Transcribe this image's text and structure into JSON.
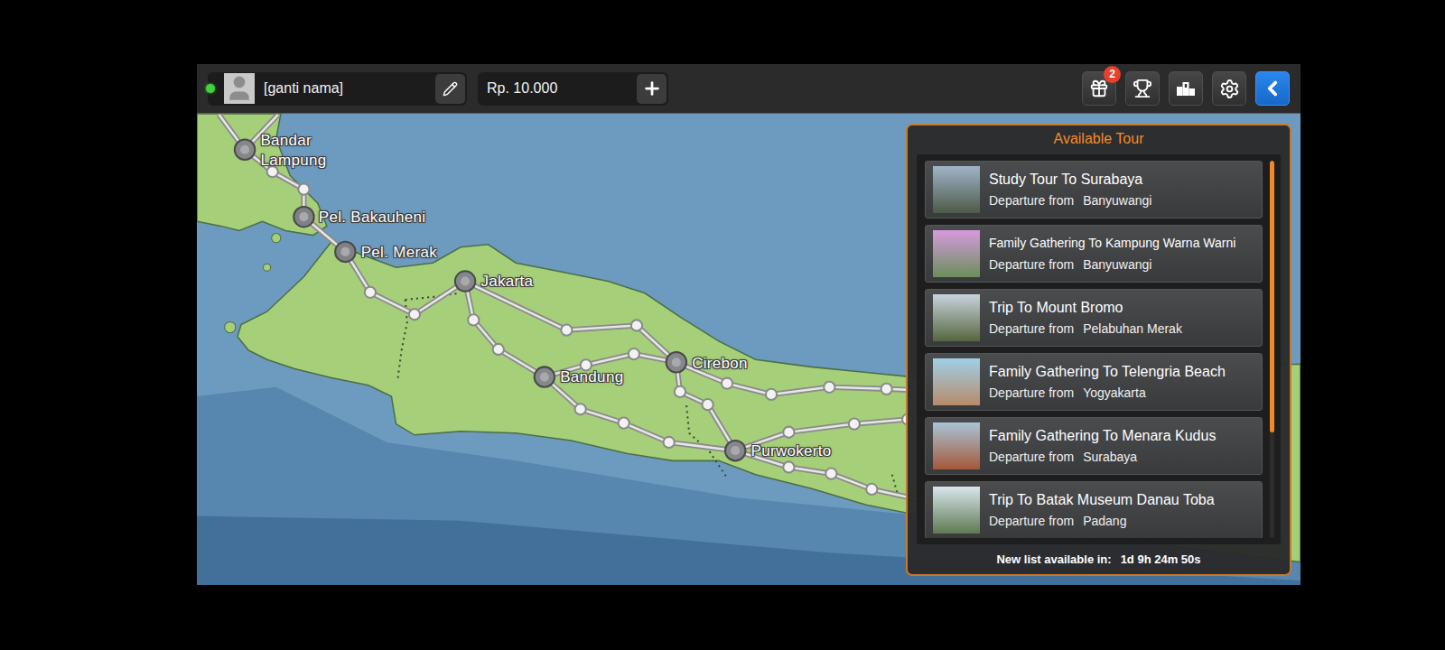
{
  "player": {
    "online": true,
    "name": "[ganti nama]"
  },
  "wallet": {
    "balance": "Rp. 10.000"
  },
  "toolbar": {
    "gift_badge": "2"
  },
  "map": {
    "cities": [
      {
        "name": "Bandar Lampung",
        "kind": "city"
      },
      {
        "name": "Pel. Bakauheni",
        "kind": "port"
      },
      {
        "name": "Pel. Merak",
        "kind": "port"
      },
      {
        "name": "Jakarta",
        "kind": "city"
      },
      {
        "name": "Bandung",
        "kind": "city"
      },
      {
        "name": "Cirebon",
        "kind": "city"
      },
      {
        "name": "Purwokerto",
        "kind": "city"
      }
    ]
  },
  "tour_panel": {
    "title": "Available Tour",
    "tours": [
      {
        "title": "Study Tour To Surabaya",
        "departure_label": "Departure from",
        "departure": "Banyuwangi"
      },
      {
        "title": "Family Gathering To Kampung Warna Warni",
        "departure_label": "Departure from",
        "departure": "Banyuwangi"
      },
      {
        "title": "Trip To Mount Bromo",
        "departure_label": "Departure from",
        "departure": "Pelabuhan Merak"
      },
      {
        "title": "Family Gathering To Telengria Beach",
        "departure_label": "Departure from",
        "departure": "Yogyakarta"
      },
      {
        "title": "Family Gathering To Menara Kudus",
        "departure_label": "Departure from",
        "departure": "Surabaya"
      },
      {
        "title": "Trip To Batak Museum Danau Toba",
        "departure_label": "Departure from",
        "departure": "Padang"
      }
    ],
    "scrollbar": {
      "level": 0.72
    },
    "footer_label": "New list available in:",
    "countdown": "1d 9h 24m 50s"
  }
}
